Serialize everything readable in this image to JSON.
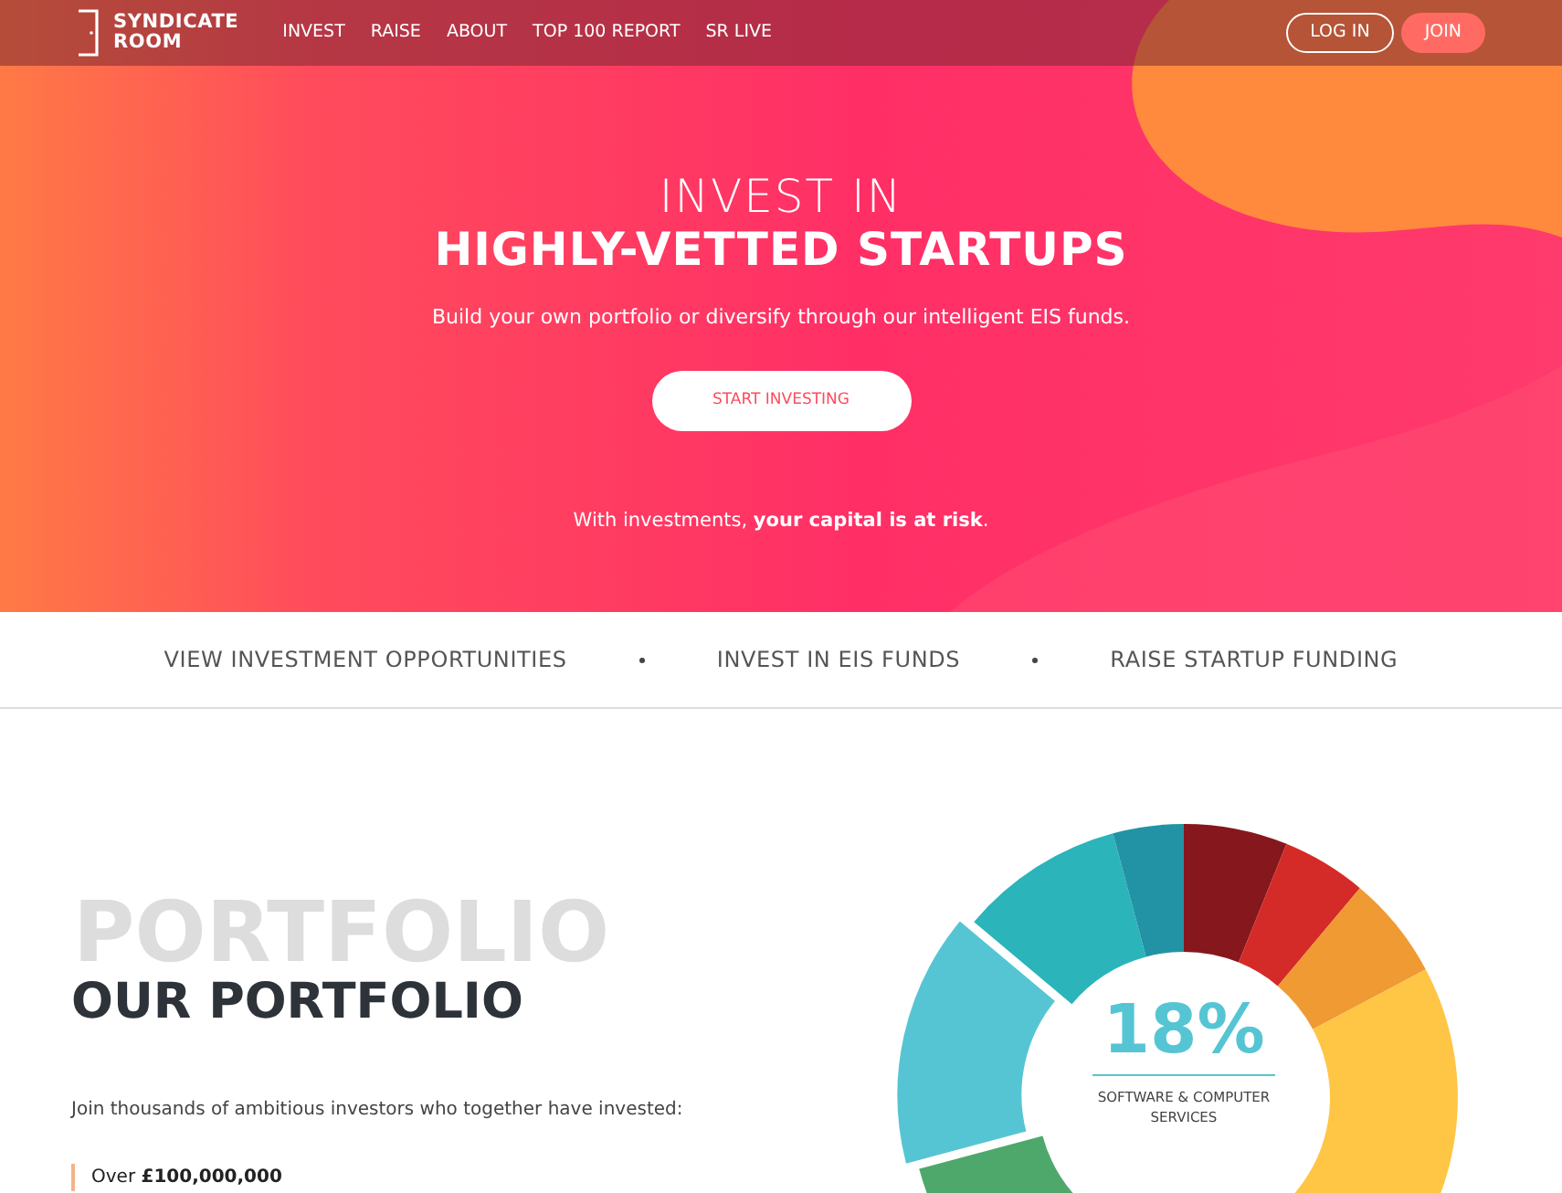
{
  "navbar": {
    "logo": [
      "SYNDICATE",
      "ROOM"
    ],
    "links": [
      "INVEST",
      "RAISE",
      "ABOUT",
      "TOP 100 REPORT",
      "SR LIVE"
    ],
    "buttons": [
      {
        "kind": "outline",
        "label": "LOG IN"
      },
      {
        "kind": "filled",
        "label": "JOIN"
      }
    ]
  },
  "hero": {
    "title_light": "INVEST IN",
    "title_bold": "HIGHLY-VETTED STARTUPS",
    "subtitle": "Build your own portfolio or diversify through our intelligent EIS funds.",
    "button": "START INVESTING",
    "risk_note": "With investments, **your capital is at risk**."
  },
  "quick_links": [
    "VIEW INVESTMENT OPPORTUNITIES",
    "INVEST IN EIS FUNDS",
    "RAISE STARTUP FUNDING"
  ],
  "portfolio": {
    "watermark": "PORTFOLIO",
    "title": "OUR PORTFOLIO",
    "intro": "Join thousands of ambitious investors who together have invested:",
    "stats": [
      "Over **£100,000,000**"
    ],
    "donut_center": {
      "percent": "18%",
      "label": "SOFTWARE & COMPUTER SERVICES"
    }
  }
}
